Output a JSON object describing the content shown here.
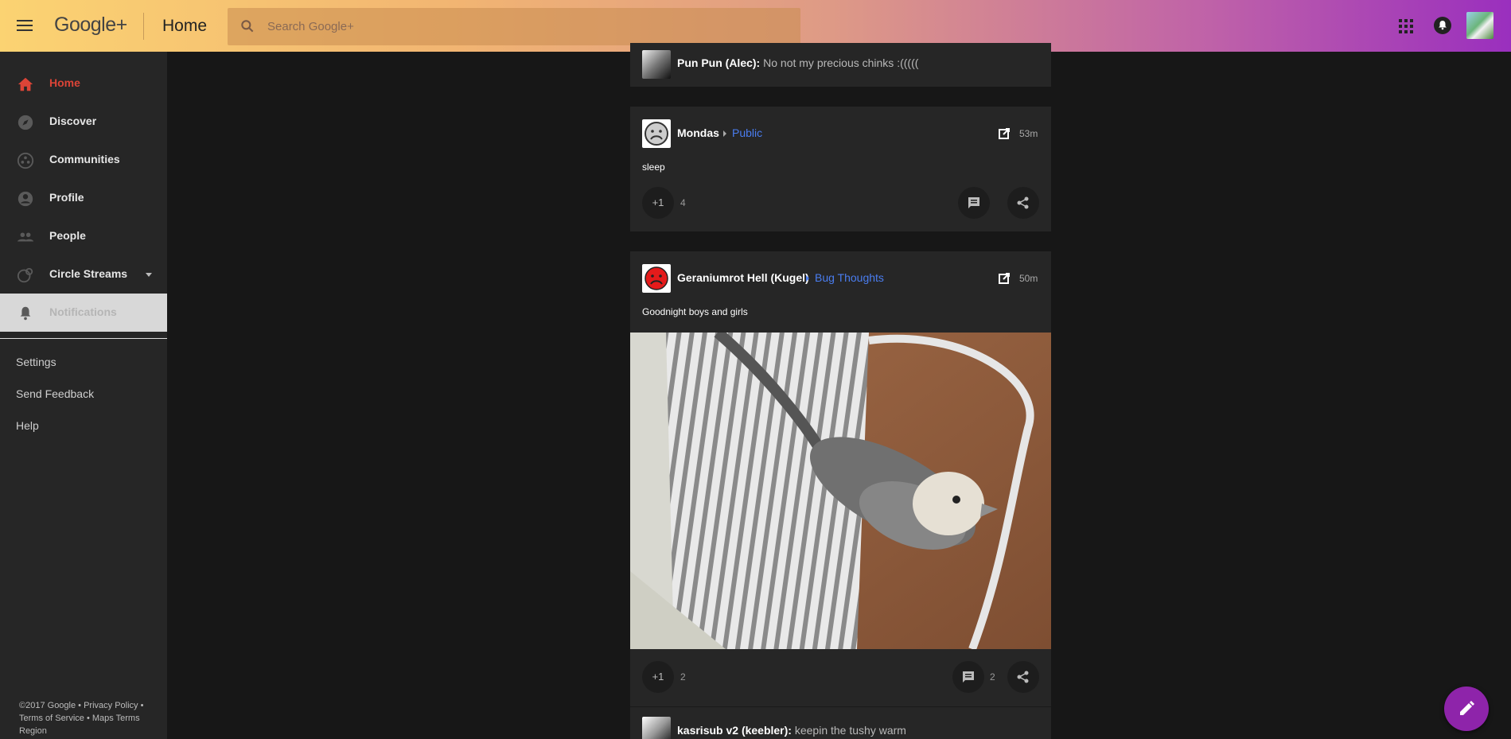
{
  "header": {
    "logo": "Google+",
    "title": "Home",
    "search_placeholder": "Search Google+",
    "accent_gradient": [
      "#fbd372",
      "#9a2fbe"
    ]
  },
  "sidebar": {
    "items": [
      {
        "label": "Home",
        "icon": "home-icon",
        "state": "active"
      },
      {
        "label": "Discover",
        "icon": "compass-icon"
      },
      {
        "label": "Communities",
        "icon": "communities-icon"
      },
      {
        "label": "Profile",
        "icon": "profile-icon"
      },
      {
        "label": "People",
        "icon": "people-icon"
      },
      {
        "label": "Circle Streams",
        "icon": "circle-streams-icon"
      },
      {
        "label": "Notifications",
        "icon": "bell-icon",
        "state": "selected"
      }
    ],
    "links": [
      "Settings",
      "Send Feedback",
      "Help"
    ],
    "footer": {
      "copyright": "©2017 Google",
      "privacy": "Privacy Policy",
      "terms": "Terms of Service",
      "maps_terms": "Maps Terms",
      "region": "Region"
    },
    "active_color": "#db4437"
  },
  "feed": {
    "top_comment": {
      "author": "Pun Pun (Alec):",
      "text": "No not my precious chinks :((((("
    },
    "posts": [
      {
        "author": "Mondas",
        "audience": "Public",
        "time": "53m",
        "text": "sleep",
        "plus_label": "+1",
        "plus_count": "4"
      },
      {
        "author": "Geraniumrot Hell (Kugel)",
        "audience": "Bug Thoughts",
        "time": "50m",
        "text": "Goodnight boys and girls",
        "plus_label": "+1",
        "plus_count": "2",
        "comment_count": "2",
        "image": "cockatiel-photo",
        "bottom_comment": {
          "author": "kasrisub v2 (keebler):",
          "text": "keepin the tushy warm"
        }
      }
    ],
    "audience_color": "#4a7df0"
  },
  "fab": {
    "icon": "pencil-icon",
    "color": "#8e24aa"
  }
}
